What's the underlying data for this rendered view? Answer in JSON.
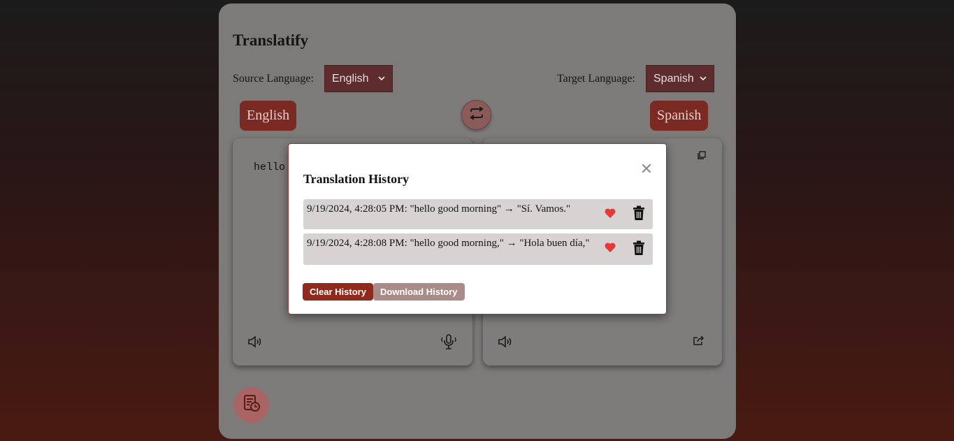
{
  "app": {
    "title": "Translatify"
  },
  "source": {
    "label": "Source Language:",
    "selected": "English",
    "badge": "English",
    "text": "hello"
  },
  "target": {
    "label": "Target Language:",
    "selected": "Spanish",
    "badge": "Spanish"
  },
  "icons": {
    "swap": "swap-arrows-icon",
    "speaker": "speaker-icon",
    "microphone": "microphone-icon",
    "copy": "copy-icon",
    "share": "share-icon",
    "history": "history-icon",
    "heart": "heart-icon",
    "trash": "trash-icon",
    "close": "close-icon"
  },
  "colors": {
    "accent": "#8f2a1c",
    "heart": "#e53935"
  },
  "modal": {
    "title": "Translation History",
    "close_glyph": "✕",
    "items": [
      {
        "text": "9/19/2024, 4:28:05 PM: \"hello good morning\" → \"Sí. Vamos.\""
      },
      {
        "text": "9/19/2024, 4:28:08 PM: \"hello good morning,\" → \"Hola buen día,\""
      }
    ],
    "clear_label": "Clear History",
    "download_label": "Download History"
  }
}
